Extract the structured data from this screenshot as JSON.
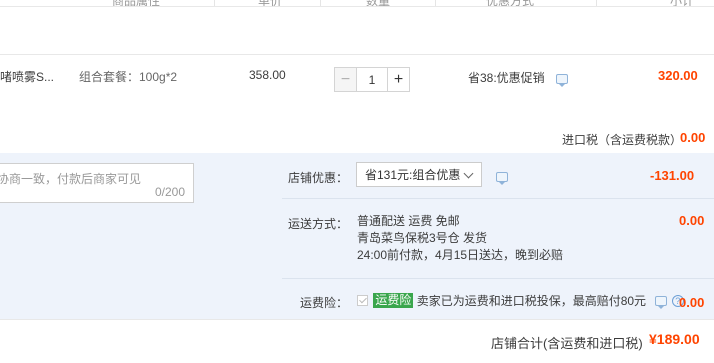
{
  "columns": {
    "attributes": "商品属性",
    "unit_price": "单价",
    "quantity": "数量",
    "discount_method": "优惠方式",
    "subtotal": "小计"
  },
  "item": {
    "name_fragment": "啫喷雾S...",
    "package": "组合套餐：100g*2",
    "unit_price": "358.00",
    "quantity": "1",
    "minus": "−",
    "plus": "+",
    "promo": "省38:优惠促销",
    "subtotal": "320.00"
  },
  "import_tax": {
    "label": "进口税（含运费税款）",
    "value": "0.00"
  },
  "message": {
    "placeholder": "协商一致，付款后商家可见",
    "counter": "0/200"
  },
  "shop_discount": {
    "label": "店铺优惠：",
    "selected": "省131元:组合优惠",
    "value": "-131.00"
  },
  "shipping": {
    "label": "运送方式：",
    "line1": "普通配送 运费 免邮",
    "line2": "青岛菜鸟保税3号仓  发货",
    "line3": "24:00前付款，4月15日送达，晚到必赔",
    "value": "0.00"
  },
  "insurance": {
    "label": "运费险：",
    "tag": "运费险",
    "desc": "卖家已为运费和进口税投保，最高赔付80元",
    "value": "0.00"
  },
  "total": {
    "label": "店铺合计(含运费和进口税)",
    "value": "¥189.00"
  }
}
